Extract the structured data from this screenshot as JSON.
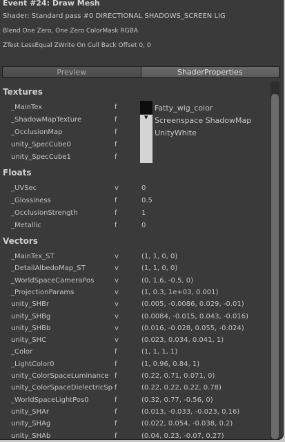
{
  "header": {
    "title": "Event #24: Draw Mesh",
    "shader_line": "Shader: Standard pass #0  DIRECTIONAL SHADOWS_SCREEN LIG",
    "blend_line": "Blend One Zero, One Zero ColorMask RGBA",
    "ztest_line": "ZTest LessEqual ZWrite On Cull Back Offset 0, 0"
  },
  "tabs": [
    {
      "label": "Preview",
      "active": false
    },
    {
      "label": "ShaderProperties",
      "active": true
    }
  ],
  "sections": {
    "textures": "Textures",
    "floats": "Floats",
    "vectors": "Vectors"
  },
  "textures": [
    {
      "name": "_MainTex",
      "type": "f"
    },
    {
      "name": "_ShadowMapTexture",
      "type": "f"
    },
    {
      "name": "_OcclusionMap",
      "type": "f"
    },
    {
      "name": "unity_SpecCube0",
      "type": "f"
    },
    {
      "name": "unity_SpecCube1",
      "type": "f"
    }
  ],
  "texture_names": [
    "Fatty_wig_color",
    "Screenspace ShadowMap",
    "UnityWhite"
  ],
  "floats": [
    {
      "name": "_UVSec",
      "type": "v",
      "value": "0"
    },
    {
      "name": "_Glossiness",
      "type": "f",
      "value": "0.5"
    },
    {
      "name": "_OcclusionStrength",
      "type": "f",
      "value": "1"
    },
    {
      "name": "_Metallic",
      "type": "f",
      "value": "0"
    }
  ],
  "vectors": [
    {
      "name": "_MainTex_ST",
      "type": "v",
      "value": "(1, 1, 0, 0)"
    },
    {
      "name": "_DetailAlbedoMap_ST",
      "type": "v",
      "value": "(1, 1, 0, 0)"
    },
    {
      "name": "_WorldSpaceCameraPos",
      "type": "v",
      "value": "(0, 1.6, -0.5, 0)"
    },
    {
      "name": "_ProjectionParams",
      "type": "v",
      "value": "(1, 0.3, 1e+03, 0.001)"
    },
    {
      "name": "unity_SHBr",
      "type": "v",
      "value": "(0.005, -0.0086, 0.029, -0.01)"
    },
    {
      "name": "unity_SHBg",
      "type": "v",
      "value": "(0.0084, -0.015, 0.043, -0.016)"
    },
    {
      "name": "unity_SHBb",
      "type": "v",
      "value": "(0.016, -0.028, 0.055, -0.024)"
    },
    {
      "name": "unity_SHC",
      "type": "v",
      "value": "(0.023, 0.034, 0.041, 1)"
    },
    {
      "name": "_Color",
      "type": "f",
      "value": "(1, 1, 1, 1)"
    },
    {
      "name": "_LightColor0",
      "type": "f",
      "value": "(1, 0.96, 0.84, 1)"
    },
    {
      "name": "unity_ColorSpaceLuminance",
      "type": "f",
      "value": "(0.22, 0.71, 0.071, 0)"
    },
    {
      "name": "unity_ColorSpaceDielectricSpec",
      "type": "f",
      "value": "(0.22, 0.22, 0.22, 0.78)"
    },
    {
      "name": "_WorldSpaceLightPos0",
      "type": "f",
      "value": "(0.32, 0.77, -0.56, 0)"
    },
    {
      "name": "unity_SHAr",
      "type": "f",
      "value": "(0.013, -0.033, -0.023, 0.16)"
    },
    {
      "name": "unity_SHAg",
      "type": "f",
      "value": "(0.022, 0.054, -0.038, 0.2)"
    },
    {
      "name": "unity_SHAb",
      "type": "f",
      "value": "(0.04, 0.23, -0.07, 0.27)"
    }
  ],
  "colors": {
    "panel_bg": "#3a3a3a",
    "text": "#c4c4c4",
    "active_tab": "#5e5e5e"
  }
}
